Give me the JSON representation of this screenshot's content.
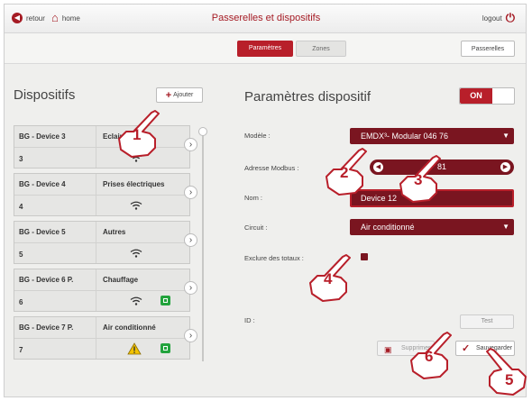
{
  "topbar": {
    "back_label": "retour",
    "home_label": "home",
    "title": "Passerelles et dispositifs",
    "logout_label": "logout",
    "icons": {
      "back": "arrow-left-circle-icon",
      "home": "home-icon",
      "logout": "power-icon"
    }
  },
  "tabs": {
    "parametres": "Paramètres",
    "zones": "Zones",
    "passerelles": "Passerelles"
  },
  "left": {
    "title": "Dispositifs",
    "add_label": "Ajouter",
    "devices": [
      {
        "name": "BG - Device 3",
        "circuit": "Eclairage",
        "address": "3",
        "icon": "wifi-icon",
        "status": ""
      },
      {
        "name": "BG - Device 4",
        "circuit": "Prises électriques",
        "address": "4",
        "icon": "wifi-icon",
        "status": ""
      },
      {
        "name": "BG - Device 5",
        "circuit": "Autres",
        "address": "5",
        "icon": "wifi-icon",
        "status": ""
      },
      {
        "name": "BG - Device 6 P.",
        "circuit": "Chauffage",
        "address": "6",
        "icon": "wifi-icon",
        "status": "ok"
      },
      {
        "name": "BG - Device 7 P.",
        "circuit": "Air conditionné",
        "address": "7",
        "icon": "warning-icon",
        "status": "ok"
      }
    ]
  },
  "right": {
    "title": "Paramètres dispositif",
    "toggle_label": "ON",
    "modele_label": "Modèle :",
    "modele_value": "EMDX³- Modular 046 76",
    "modbus_label": "Adresse Modbus :",
    "modbus_value": "81",
    "nom_label": "Nom :",
    "nom_value": "Device 12",
    "circuit_label": "Circuit :",
    "circuit_value": "Air conditionné",
    "exclure_label": "Exclure des totaux :",
    "exclure_checked": true,
    "id_label": "ID :",
    "test_label": "Test",
    "delete_label": "Supprimer",
    "save_label": "Sauvegarder"
  },
  "callouts": [
    "1",
    "2",
    "3",
    "4",
    "5",
    "6"
  ],
  "colors": {
    "accent": "#b81f2a",
    "dark_accent": "#7a1520",
    "status_ok": "#22a33c",
    "warning": "#f2c200"
  }
}
